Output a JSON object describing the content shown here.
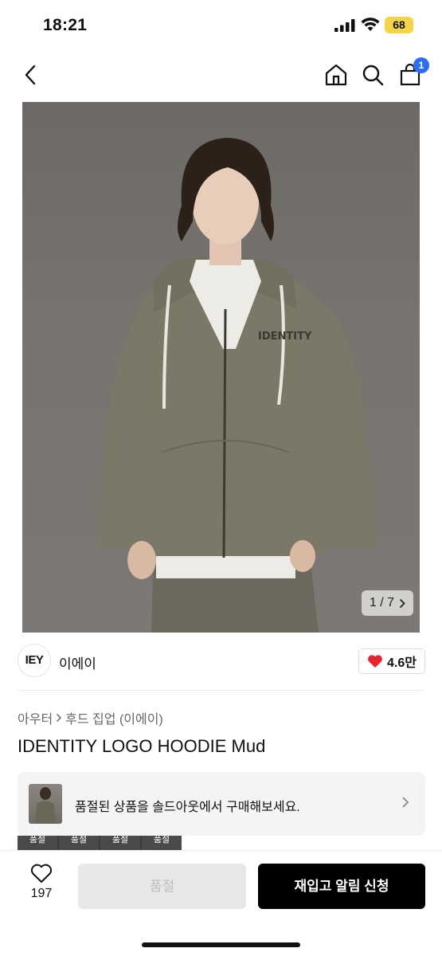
{
  "status_bar": {
    "time": "18:21",
    "battery": "68"
  },
  "nav": {
    "cart_count": "1"
  },
  "product": {
    "image_counter": "1 / 7",
    "image_print": "IDENTITY",
    "seller_logo": "IEY",
    "seller_name": "이에이",
    "likes": "4.6만",
    "breadcrumb": [
      "아우터",
      "후드 집업 (이에이)"
    ],
    "title": "IDENTITY LOGO HOODIE Mud"
  },
  "banner": {
    "text": "품절된 상품을 솔드아웃에서 구매해보세요."
  },
  "thumbs": [
    "품절",
    "품절",
    "품절",
    "품절"
  ],
  "bottom": {
    "wish_count": "197",
    "soldout_label": "품절",
    "restock_label": "재입고 알림 신청"
  },
  "colors": {
    "accent": "#2f6cf6",
    "battery": "#f5d547",
    "heart": "#e5242f"
  }
}
